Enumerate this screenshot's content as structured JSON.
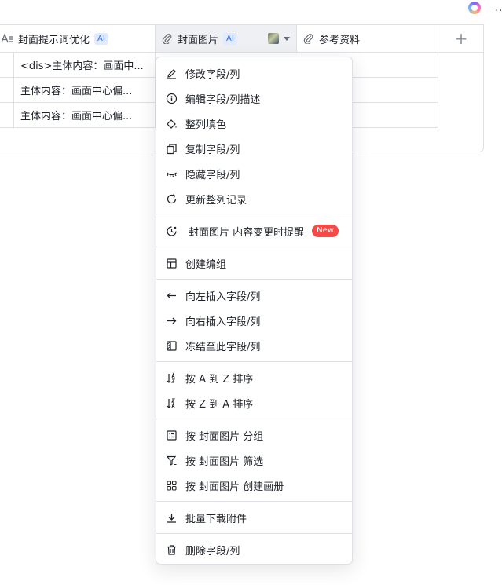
{
  "top_right": {
    "more_glyph": "…"
  },
  "table": {
    "columns": [
      {
        "label": "封面提示词优化",
        "ai": "AI"
      },
      {
        "label": "封面图片",
        "ai": "AI"
      },
      {
        "label": "参考资料"
      }
    ],
    "add_column_glyph": "+",
    "rows": [
      {
        "prompt": "<dis>主体内容：画面中..."
      },
      {
        "prompt": "主体内容：画面中心偏..."
      },
      {
        "prompt": "主体内容：画面中心偏..."
      }
    ]
  },
  "menu": {
    "items": [
      {
        "label": "修改字段/列",
        "icon": "pencil-icon"
      },
      {
        "label": "编辑字段/列描述",
        "icon": "info-icon"
      },
      {
        "label": "整列填色",
        "icon": "paint-bucket-icon"
      },
      {
        "label": "复制字段/列",
        "icon": "copy-icon"
      },
      {
        "label": "隐藏字段/列",
        "icon": "eye-closed-icon"
      },
      {
        "label": "更新整列记录",
        "icon": "refresh-icon"
      },
      {
        "label": "封面图片 内容变更时提醒",
        "icon": "clock-alert-icon",
        "badge": "New"
      },
      {
        "label": "创建编组",
        "icon": "group-layout-icon"
      },
      {
        "label": "向左插入字段/列",
        "icon": "arrow-left-icon"
      },
      {
        "label": "向右插入字段/列",
        "icon": "arrow-right-icon"
      },
      {
        "label": "冻结至此字段/列",
        "icon": "freeze-icon"
      },
      {
        "label": "按 A 到 Z 排序",
        "icon": "sort-asc-icon"
      },
      {
        "label": "按 Z 到 A 排序",
        "icon": "sort-desc-icon"
      },
      {
        "label": "按 封面图片 分组",
        "icon": "list-group-icon"
      },
      {
        "label": "按 封面图片 筛选",
        "icon": "filter-icon"
      },
      {
        "label": "按 封面图片 创建画册",
        "icon": "gallery-icon"
      },
      {
        "label": "批量下载附件",
        "icon": "download-icon"
      },
      {
        "label": "删除字段/列",
        "icon": "trash-icon"
      }
    ]
  },
  "colors": {
    "accent": "#3370ff",
    "badge_red": "#f54a45",
    "border": "#dee0e3",
    "text": "#1f2329"
  }
}
